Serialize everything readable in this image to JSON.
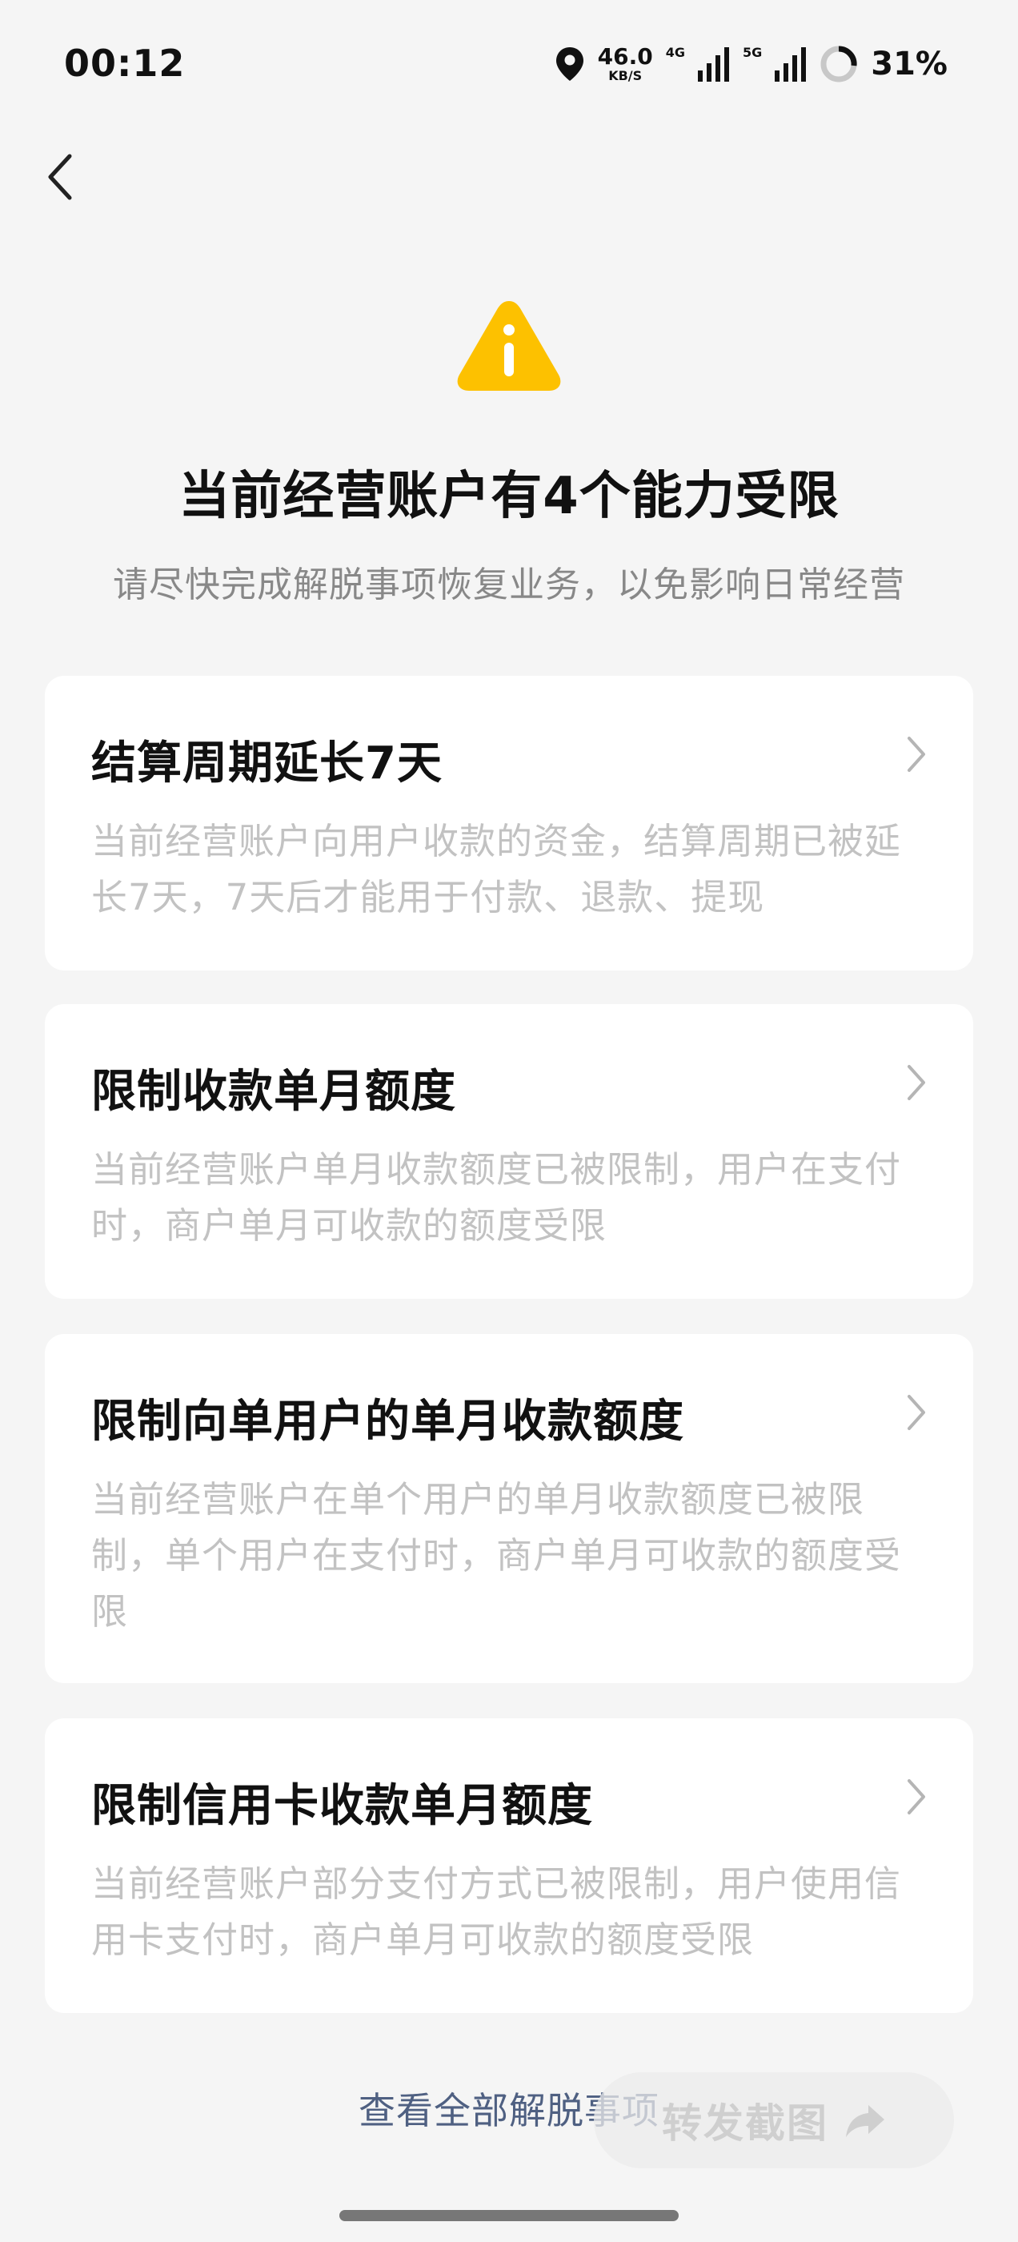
{
  "status_bar": {
    "time": "00:12",
    "net_speed_value": "46.0",
    "net_speed_unit": "KB/S",
    "signal1_label": "4G",
    "signal2_label": "5G",
    "battery": "31%"
  },
  "header": {
    "title": "当前经营账户有4个能力受限",
    "subtitle": "请尽快完成解脱事项恢复业务，以免影响日常经营"
  },
  "cards": [
    {
      "title": "结算周期延长7天",
      "description": "当前经营账户向用户收款的资金，结算周期已被延长7天，7天后才能用于付款、退款、提现"
    },
    {
      "title": "限制收款单月额度",
      "description": "当前经营账户单月收款额度已被限制，用户在支付时，商户单月可收款的额度受限"
    },
    {
      "title": "限制向单用户的单月收款额度",
      "description": "当前经营账户在单个用户的单月收款额度已被限制，单个用户在支付时，商户单月可收款的额度受限"
    },
    {
      "title": "限制信用卡收款单月额度",
      "description": "当前经营账户部分支付方式已被限制，用户使用信用卡支付时，商户单月可收款的额度受限"
    }
  ],
  "footer": {
    "view_all_label": "查看全部解脱事项",
    "forward_screenshot_label": "转发截图"
  },
  "colors": {
    "warning": "#fdc100",
    "link": "#4f6082"
  }
}
